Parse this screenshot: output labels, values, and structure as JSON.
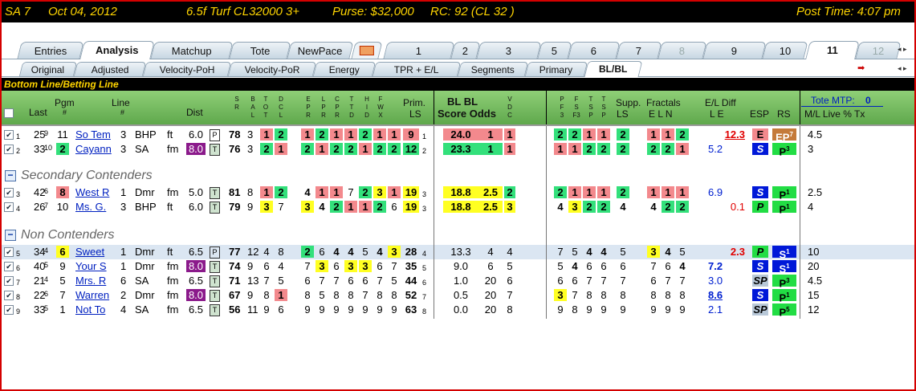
{
  "title": {
    "race": "SA  7",
    "date": "Oct 04, 2012",
    "conditions": "6.5f  Turf  CL32000  3+",
    "purse": "Purse: $32,000",
    "rc": "RC: 92  (CL 32 )",
    "post": "Post Time: 4:07 pm"
  },
  "tabs": [
    "Entries",
    "Analysis",
    "Matchup",
    "Tote",
    "NewPace"
  ],
  "race_tabs": [
    "1",
    "2",
    "3",
    "5",
    "6",
    "7",
    "8",
    "9",
    "10",
    "11",
    "12"
  ],
  "subtabs": [
    "Original",
    "Adjusted",
    "Velocity-PoH",
    "Velocity-PoR",
    "Energy",
    "TPR + E/L",
    "Segments",
    "Primary",
    "BL/BL"
  ],
  "panel_title": "Bottom Line/Betting Line",
  "headers": {
    "last": "Last",
    "pgm": "Pgm",
    "pgm2": "#",
    "line": "Line",
    "line2": "#",
    "dist": "Dist",
    "prim": "Prim.",
    "prim2": "LS",
    "bl1": "BL  BL",
    "bl2": "Score  Odds",
    "supp": "Supp.",
    "supp2": "LS",
    "fract": "Fractals",
    "fract2": "E  L  N",
    "eldiff": "E/L  Diff",
    "eldiff2": "L     E",
    "esp": "ESP",
    "rs": "RS",
    "tote": "Tote MTP:",
    "mtp": "0",
    "ml": "M/L  Live  %    Tx",
    "v1": [
      "S",
      "R"
    ],
    "v2": [
      "B",
      "A",
      "L"
    ],
    "v3": [
      "T",
      "O",
      "T"
    ],
    "v4": [
      "D",
      "C",
      "L"
    ],
    "v5": [
      "E",
      "P",
      "R"
    ],
    "v6": [
      "L",
      "P",
      "R"
    ],
    "v7": [
      "C",
      "P",
      "R"
    ],
    "v8": [
      "T",
      "T",
      "D"
    ],
    "v9": [
      "H",
      "I",
      "D"
    ],
    "v10": [
      "F",
      "W",
      "X"
    ],
    "v11": [
      "V",
      "D",
      "C"
    ],
    "v12": [
      "P",
      "F",
      "3"
    ],
    "v13": [
      "F",
      "S",
      "F3"
    ],
    "v14": [
      "T",
      "S",
      "P"
    ],
    "v15": [
      "T",
      "S",
      "P"
    ]
  },
  "sections": {
    "secondary": "Secondary Contenders",
    "non": "Non Contenders"
  },
  "rows": [
    {
      "n": "1",
      "last": "25",
      "lastsup": "9",
      "pgm": "11",
      "name": "So Tem",
      "line": "3",
      "trk": "BHP",
      "surf": "ft",
      "dist": "6.0",
      "dt": "P",
      "sr": "78",
      "bal": "3",
      "tot": "1",
      "dcl": "2",
      "f": [
        "1",
        "2",
        "1",
        "1",
        "2",
        "1",
        "1"
      ],
      "prim": "9",
      "primsub": "1",
      "bls": "24.0",
      "blo": "1",
      "vdc": "1",
      "p1": "2",
      "p2": "2",
      "p3": "1",
      "p4": "1",
      "supp": "2",
      "e": "1",
      "l": "1",
      "nn": "2",
      "eld": "12.3",
      "esp": "E",
      "rs": "EP",
      "rssup": "7",
      "ml": "4.5"
    },
    {
      "n": "2",
      "last": "33",
      "lastsup": "10",
      "pgm": "2",
      "name": "Cayann",
      "line": "3",
      "trk": "SA",
      "surf": "fm",
      "dist": "8.0",
      "dt": "T",
      "sr": "76",
      "bal": "3",
      "tot": "2",
      "dcl": "1",
      "f": [
        "2",
        "1",
        "2",
        "2",
        "1",
        "2",
        "2"
      ],
      "prim": "12",
      "primsub": "2",
      "bls": "23.3",
      "blo": "1",
      "vdc": "1",
      "p1": "1",
      "p2": "1",
      "p3": "2",
      "p4": "2",
      "supp": "2",
      "e": "2",
      "l": "2",
      "nn": "1",
      "eld": "5.2",
      "esp": "S",
      "rs": "P",
      "rssup": "3",
      "ml": "3"
    },
    {
      "n": "3",
      "last": "42",
      "lastsup": "6",
      "pgm": "8",
      "name": "West R",
      "line": "1",
      "trk": "Dmr",
      "surf": "fm",
      "dist": "5.0",
      "dt": "T",
      "sr": "81",
      "bal": "8",
      "tot": "1",
      "dcl": "2",
      "f": [
        "4",
        "1",
        "1",
        "7",
        "2",
        "3",
        "1"
      ],
      "prim": "19",
      "primsub": "3",
      "bls": "18.8",
      "blo": "2.5",
      "vdc": "2",
      "p1": "2",
      "p2": "1",
      "p3": "1",
      "p4": "1",
      "supp": "2",
      "e": "1",
      "l": "1",
      "nn": "1",
      "eld": "6.9",
      "esp": "S",
      "rs": "P",
      "rssup": "1",
      "ml": "2.5"
    },
    {
      "n": "4",
      "last": "26",
      "lastsup": "7",
      "pgm": "10",
      "name": "Ms. G.",
      "line": "3",
      "trk": "BHP",
      "surf": "ft",
      "dist": "6.0",
      "dt": "T",
      "sr": "79",
      "bal": "9",
      "tot": "3",
      "dcl": "7",
      "f": [
        "3",
        "4",
        "2",
        "1",
        "1",
        "2",
        "6"
      ],
      "prim": "19",
      "primsub": "3",
      "bls": "18.8",
      "blo": "2.5",
      "vdc": "3",
      "p1": "4",
      "p2": "3",
      "p3": "2",
      "p4": "2",
      "supp": "4",
      "e": "4",
      "l": "2",
      "nn": "2",
      "eld": "0.1",
      "esp": "P",
      "rs": "P",
      "rssup": "1",
      "ml": "4"
    },
    {
      "n": "5",
      "last": "34",
      "lastsup": "4",
      "pgm": "6",
      "name": "Sweet",
      "line": "1",
      "trk": "Dmr",
      "surf": "ft",
      "dist": "6.5",
      "dt": "P",
      "sr": "77",
      "bal": "12",
      "tot": "4",
      "dcl": "8",
      "f": [
        "2",
        "6",
        "4",
        "4",
        "5",
        "4",
        "3"
      ],
      "prim": "28",
      "primsub": "4",
      "bls": "13.3",
      "blo": "4",
      "vdc": "4",
      "p1": "7",
      "p2": "5",
      "p3": "4",
      "p4": "4",
      "supp": "5",
      "e": "3",
      "l": "4",
      "nn": "5",
      "eld": "2.3",
      "esp": "P",
      "rs": "S",
      "rssup": "1",
      "ml": "10"
    },
    {
      "n": "6",
      "last": "40",
      "lastsup": "5",
      "pgm": "9",
      "name": "Your S",
      "line": "1",
      "trk": "Dmr",
      "surf": "fm",
      "dist": "8.0",
      "dt": "T",
      "sr": "74",
      "bal": "9",
      "tot": "6",
      "dcl": "4",
      "f": [
        "7",
        "3",
        "6",
        "3",
        "3",
        "6",
        "7"
      ],
      "prim": "35",
      "primsub": "5",
      "bls": "9.0",
      "blo": "6",
      "vdc": "5",
      "p1": "5",
      "p2": "4",
      "p3": "6",
      "p4": "6",
      "supp": "6",
      "e": "7",
      "l": "6",
      "nn": "4",
      "eld": "7.2",
      "esp": "S",
      "rs": "S",
      "rssup": "1",
      "ml": "20"
    },
    {
      "n": "7",
      "last": "21",
      "lastsup": "4",
      "pgm": "5",
      "name": "Mrs. R",
      "line": "6",
      "trk": "SA",
      "surf": "fm",
      "dist": "6.5",
      "dt": "T",
      "sr": "71",
      "bal": "13",
      "tot": "7",
      "dcl": "5",
      "f": [
        "6",
        "7",
        "7",
        "6",
        "6",
        "7",
        "5"
      ],
      "prim": "44",
      "primsub": "6",
      "bls": "1.0",
      "blo": "20",
      "vdc": "6",
      "p1": "6",
      "p2": "6",
      "p3": "7",
      "p4": "7",
      "supp": "7",
      "e": "6",
      "l": "7",
      "nn": "7",
      "eld": "3.0",
      "esp": "SP",
      "rs": "P",
      "rssup": "3",
      "ml": "4.5"
    },
    {
      "n": "8",
      "last": "22",
      "lastsup": "6",
      "pgm": "7",
      "name": "Warren",
      "line": "2",
      "trk": "Dmr",
      "surf": "fm",
      "dist": "8.0",
      "dt": "T",
      "sr": "67",
      "bal": "9",
      "tot": "8",
      "dcl": "1",
      "f": [
        "8",
        "5",
        "8",
        "8",
        "7",
        "8",
        "8"
      ],
      "prim": "52",
      "primsub": "7",
      "bls": "0.5",
      "blo": "20",
      "vdc": "7",
      "p1": "3",
      "p2": "7",
      "p3": "8",
      "p4": "8",
      "supp": "8",
      "e": "8",
      "l": "8",
      "nn": "8",
      "eld": "8.6",
      "esp": "S",
      "rs": "P",
      "rssup": "1",
      "ml": "15"
    },
    {
      "n": "9",
      "last": "33",
      "lastsup": "5",
      "pgm": "1",
      "name": "Not To",
      "line": "4",
      "trk": "SA",
      "surf": "fm",
      "dist": "6.5",
      "dt": "T",
      "sr": "56",
      "bal": "11",
      "tot": "9",
      "dcl": "6",
      "f": [
        "9",
        "9",
        "9",
        "9",
        "9",
        "9",
        "9"
      ],
      "prim": "63",
      "primsub": "8",
      "bls": "0.0",
      "blo": "20",
      "vdc": "8",
      "p1": "9",
      "p2": "8",
      "p3": "9",
      "p4": "9",
      "supp": "9",
      "e": "9",
      "l": "9",
      "nn": "9",
      "eld": "2.1",
      "esp": "SP",
      "rs": "P",
      "rssup": "5",
      "ml": "12"
    }
  ]
}
